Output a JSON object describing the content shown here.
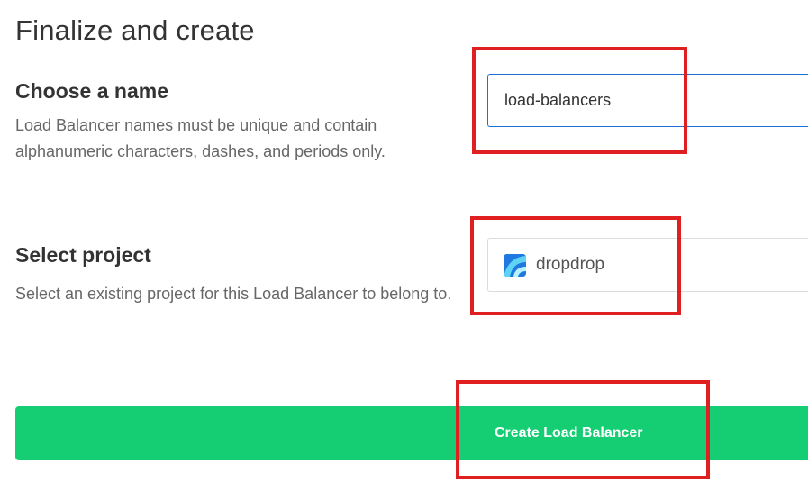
{
  "page": {
    "title": "Finalize and create"
  },
  "name_section": {
    "title": "Choose a name",
    "description": "Load Balancer names must be unique and contain alphanumeric characters, dashes, and periods only.",
    "input_value": "load-balancers"
  },
  "project_section": {
    "title": "Select project",
    "description": "Select an existing project for this Load Balancer to belong to.",
    "selected_project": "dropdrop",
    "project_icon": "project-logo-icon"
  },
  "actions": {
    "create_label": "Create Load Balancer"
  },
  "colors": {
    "create_button": "#15cd72",
    "input_focus_border": "#1d6fd6",
    "annotation": "#e02020",
    "project_icon": "#1f79e0"
  }
}
